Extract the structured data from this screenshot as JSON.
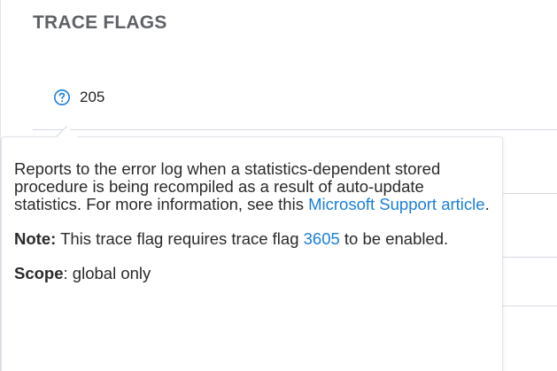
{
  "section": {
    "title": "TRACE FLAGS"
  },
  "flag": {
    "number": "205",
    "help_icon": "question-circle-icon"
  },
  "tooltip": {
    "description": "Reports to the error log when a statistics-dependent stored procedure is being recompiled as a result of auto-update statistics. For more information, see this ",
    "link_text": "Microsoft Support article",
    "description_end": ".",
    "note_label": "Note:",
    "note_text": " This trace flag requires trace flag ",
    "note_link": "3605",
    "note_end": " to be enabled.",
    "scope_label": "Scope",
    "scope_text": ": global only"
  },
  "colors": {
    "accent": "#1a7fd8",
    "title": "#5f6266",
    "divider": "#d6dce4"
  }
}
